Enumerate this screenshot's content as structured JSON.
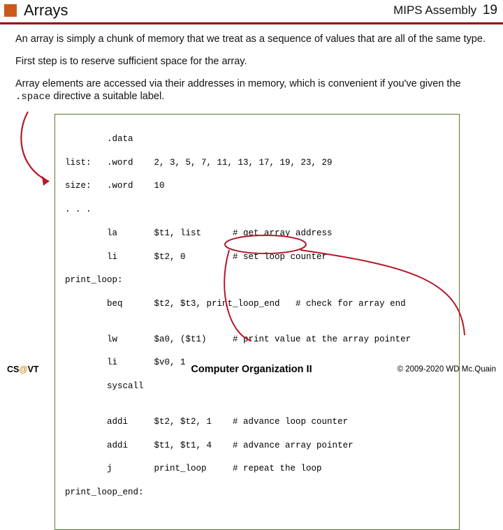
{
  "header": {
    "title": "Arrays",
    "course": "MIPS Assembly",
    "page": "19"
  },
  "body": {
    "p1": "An array is simply a chunk of memory that we treat as a sequence of values that are all of the same type.",
    "p2": "First step is to reserve sufficient space for the array.",
    "p3a": "Array elements are accessed via their addresses in memory, which is convenient if you've given the ",
    "p3code": ".space",
    "p3b": " directive a suitable label."
  },
  "code": {
    "l01": "        .data",
    "l02": "list:   .word    2, 3, 5, 7, 11, 13, 17, 19, 23, 29",
    "l03": "size:   .word    10",
    "l04": ". . .",
    "l05": "        la       $t1, list      # get array address",
    "l06": "        li       $t2, 0         # set loop counter",
    "l07": "print_loop:",
    "l08": "        beq      $t2, $t3, print_loop_end   # check for array end",
    "l09": "",
    "l10": "        lw       $a0, ($t1)     # print value at the array pointer",
    "l11": "        li       $v0, 1",
    "l12": "        syscall",
    "l13": "",
    "l14": "        addi     $t2, $t2, 1    # advance loop counter",
    "l15": "        addi     $t1, $t1, 4    # advance array pointer",
    "l16": "        j        print_loop     # repeat the loop",
    "l17": "print_loop_end:"
  },
  "footer": {
    "left_a": "CS",
    "left_at": "@",
    "left_b": "VT",
    "center": "Computer Organization II",
    "right": "© 2009-2020  WD Mc.Quain"
  }
}
